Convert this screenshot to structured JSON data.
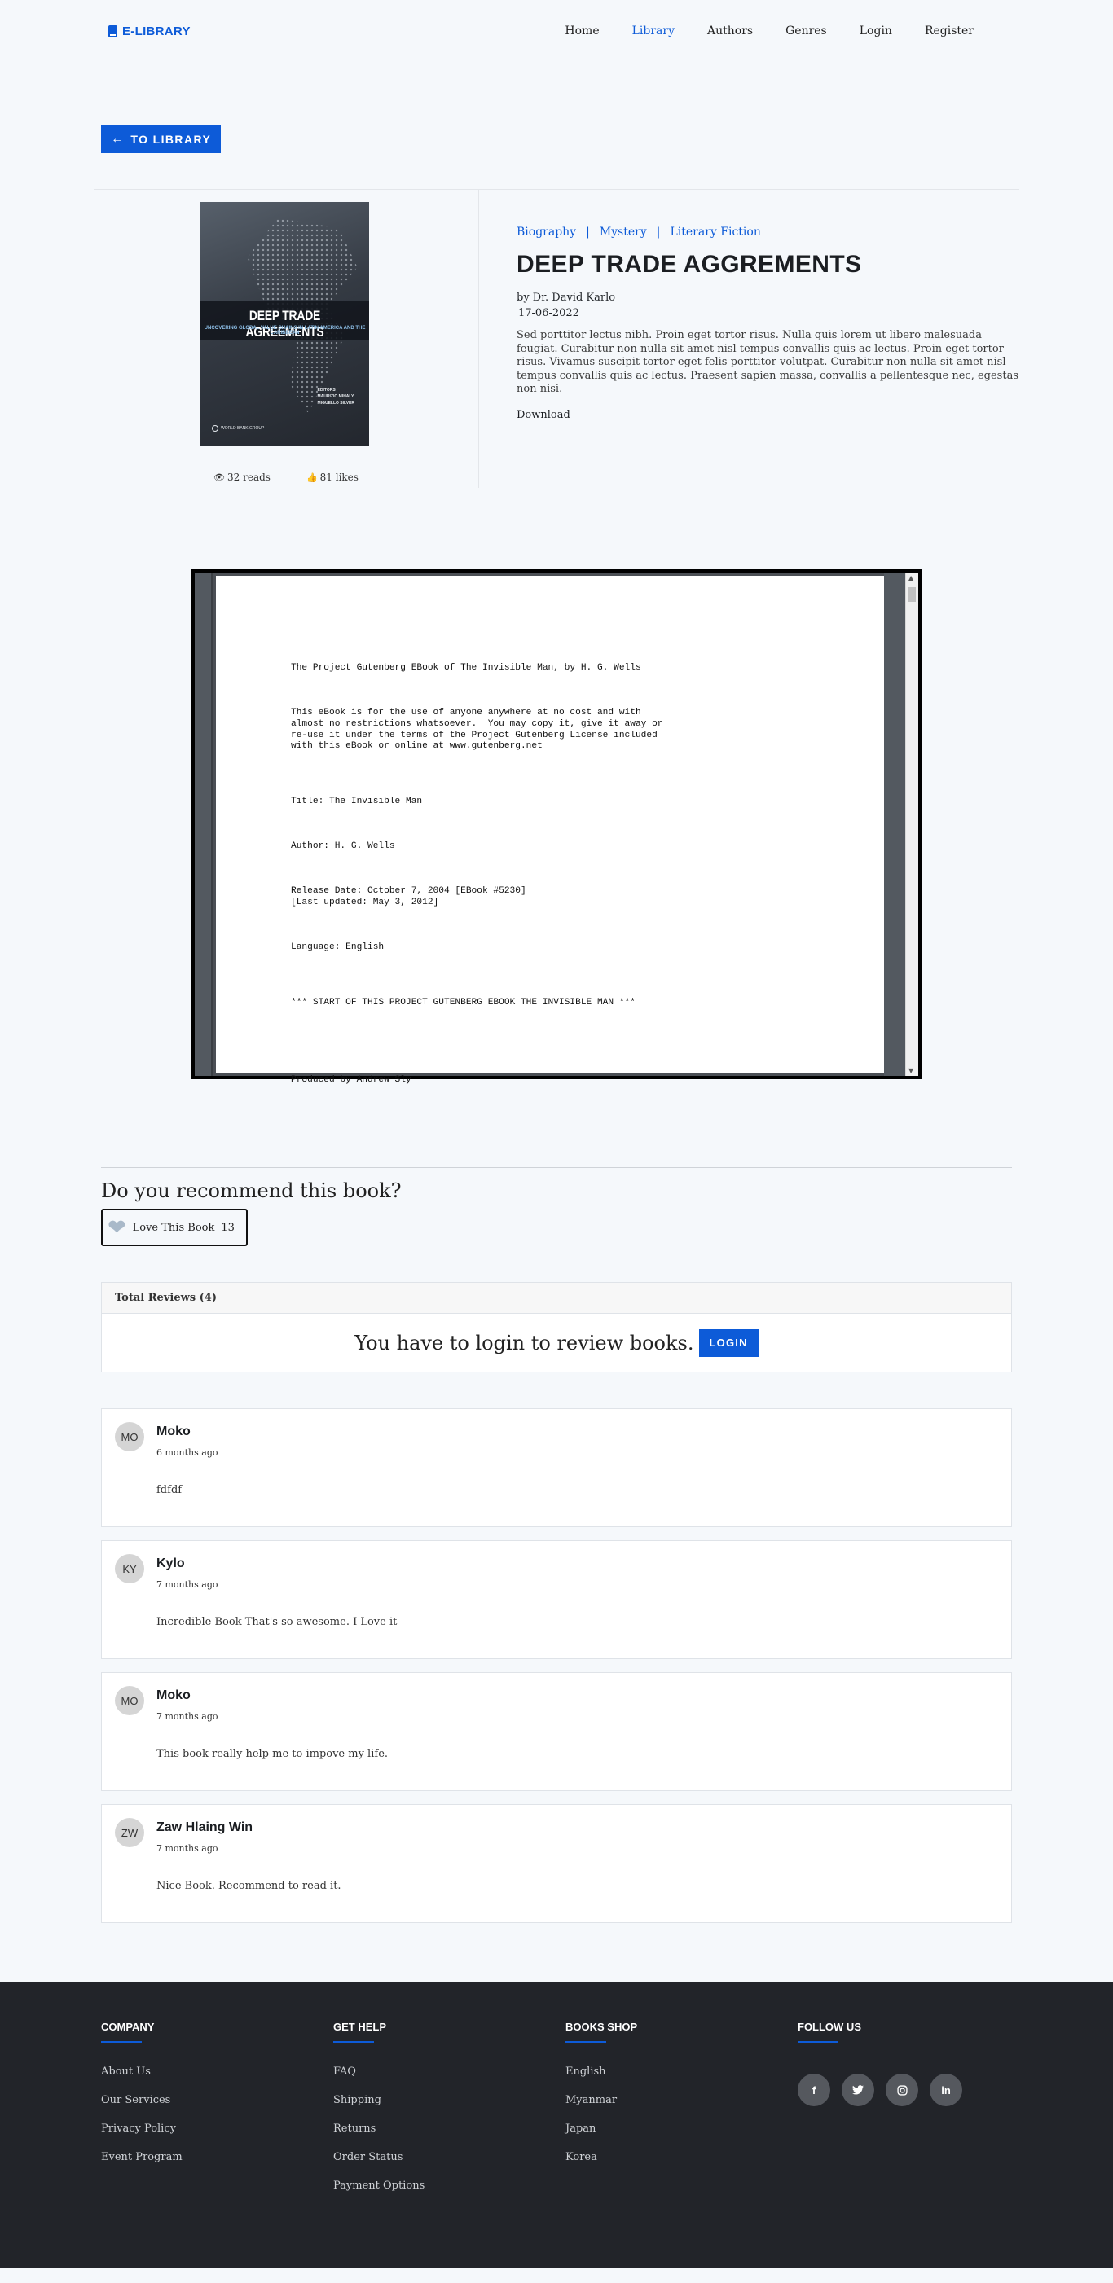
{
  "nav": {
    "brand": "E-LIBRARY",
    "items": [
      {
        "label": "Home",
        "active": false
      },
      {
        "label": "Library",
        "active": true
      },
      {
        "label": "Authors",
        "active": false
      },
      {
        "label": "Genres",
        "active": false
      },
      {
        "label": "Login",
        "active": false
      },
      {
        "label": "Register",
        "active": false
      }
    ]
  },
  "back_button": "TO LIBRARY",
  "book": {
    "cover": {
      "title": "DEEP TRADE AGREEMENTS",
      "subtitle": "UNCOVERING GLOBAL VALUE CHAINS IN LATIN AMERICA AND THE CARIBBEAN",
      "editors_label": "EDITORS",
      "editor1": "MAURIZIO MIHALY",
      "editor2": "MIGUELLO SILVER",
      "publisher": "WORLD BANK GROUP"
    },
    "reads": "32 reads",
    "likes": "81 likes",
    "categories": [
      "Biography",
      "Mystery",
      "Literary Fiction"
    ],
    "category_separator": "|",
    "title": "DEEP TRADE AGGREMENTS",
    "author": "by Dr. David Karlo",
    "date": "17-06-2022",
    "description": "Sed porttitor lectus nibh. Proin eget tortor risus. Nulla quis lorem ut libero malesuada feugiat. Curabitur non nulla sit amet nisl tempus convallis quis ac lectus. Proin eget tortor risus. Vivamus suscipit tortor eget felis porttitor volutpat. Curabitur non nulla sit amet nisl tempus convallis quis ac lectus. Praesent sapien massa, convallis a pellentesque nec, egestas non nisi.",
    "download": "Download"
  },
  "viewer": {
    "lines": [
      "The Project Gutenberg EBook of The Invisible Man, by H. G. Wells",
      "This eBook is for the use of anyone anywhere at no cost and with\nalmost no restrictions whatsoever.  You may copy it, give it away or\nre-use it under the terms of the Project Gutenberg License included\nwith this eBook or online at www.gutenberg.net",
      "Title: The Invisible Man",
      "Author: H. G. Wells",
      "Release Date: October 7, 2004 [EBook #5230]\n[Last updated: May 3, 2012]",
      "Language: English",
      "*** START OF THIS PROJECT GUTENBERG EBOOK THE INVISIBLE MAN ***",
      "Produced by Andrew Sly"
    ]
  },
  "recommend": {
    "question": "Do you recommend this book?",
    "love_label": "Love This Book",
    "love_count": "13"
  },
  "reviews": {
    "header": "Total Reviews (4)",
    "login_message": "You have to login to review books.",
    "login_button": "LOGIN",
    "items": [
      {
        "initials": "MO",
        "name": "Moko",
        "time": "6 months ago",
        "text": "fdfdf"
      },
      {
        "initials": "KY",
        "name": "Kylo",
        "time": "7 months ago",
        "text": "Incredible Book That's so awesome. I Love it"
      },
      {
        "initials": "MO",
        "name": "Moko",
        "time": "7 months ago",
        "text": "This book really help me to impove my life."
      },
      {
        "initials": "ZW",
        "name": "Zaw Hlaing Win",
        "time": "7 months ago",
        "text": "Nice Book. Recommend to read it."
      }
    ]
  },
  "footer": {
    "company": {
      "title": "COMPANY",
      "links": [
        "About Us",
        "Our Services",
        "Privacy Policy",
        "Event Program"
      ]
    },
    "help": {
      "title": "GET HELP",
      "links": [
        "FAQ",
        "Shipping",
        "Returns",
        "Order Status",
        "Payment Options"
      ]
    },
    "shop": {
      "title": "BOOKS SHOP",
      "links": [
        "English",
        "Myanmar",
        "Japan",
        "Korea"
      ]
    },
    "follow": {
      "title": "FOLLOW US",
      "icons": [
        "facebook-icon",
        "twitter-icon",
        "instagram-icon",
        "linkedin-icon"
      ]
    }
  },
  "colors": {
    "accent": "#0d5bd8",
    "footer_bg": "#222429",
    "page_bg": "#f5f8fb"
  }
}
